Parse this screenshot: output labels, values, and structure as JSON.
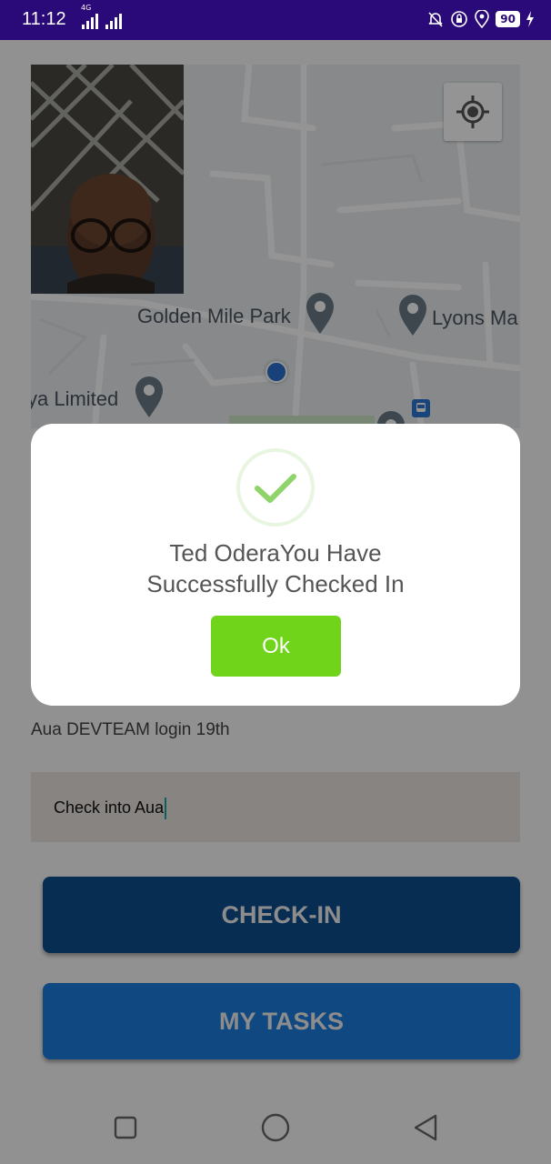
{
  "status_bar": {
    "time": "11:12",
    "network": "4G",
    "battery": "90"
  },
  "map": {
    "places": [
      "Golden Mile Park",
      "Lyons Ma",
      "ya Limited"
    ],
    "icons": [
      "my-location-icon",
      "map-pin-icon",
      "bus-stop-icon"
    ]
  },
  "task": {
    "label": "Aua DEVTEAM login 19th",
    "input_value": "Check into Aua"
  },
  "buttons": {
    "checkin": "CHECK-IN",
    "my_tasks": "MY TASKS"
  },
  "dialog": {
    "line1": "Ted OderaYou Have",
    "line2": "Successfully Checked In",
    "ok": "Ok",
    "icon": "check-icon"
  },
  "nav": {
    "icons": [
      "recents-icon",
      "home-icon",
      "back-icon"
    ]
  },
  "colors": {
    "status_bar": "#2a0a78",
    "checkin_button": "#0d4f8f",
    "tasks_button": "#1c7fe0",
    "ok_button": "#6fd41a",
    "check_mark": "#8ed46a"
  }
}
